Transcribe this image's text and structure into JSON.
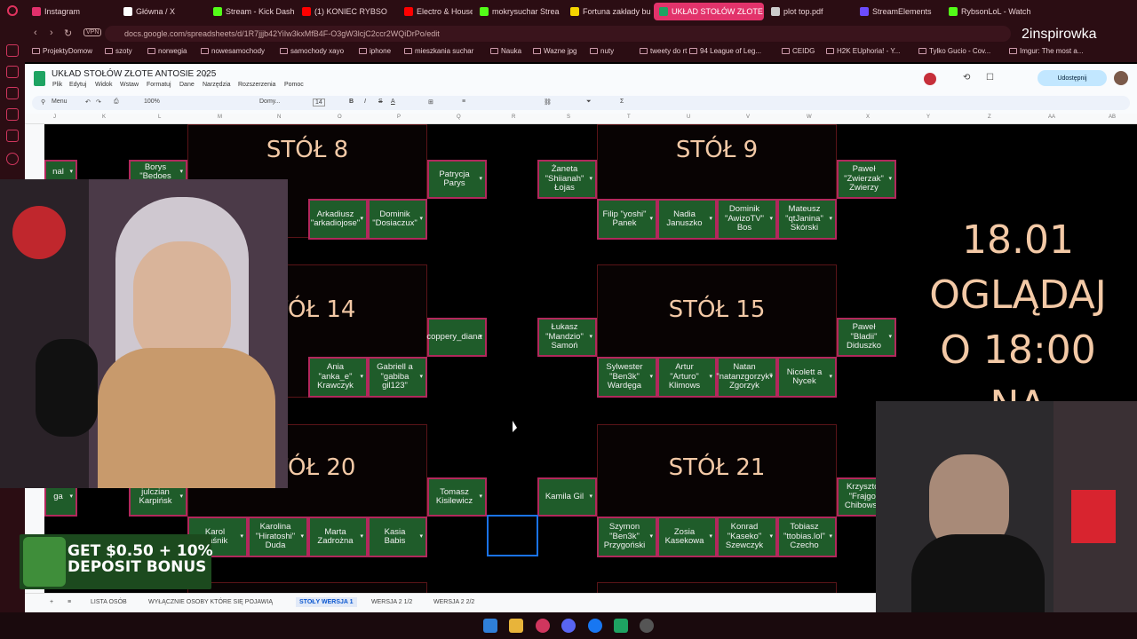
{
  "browser": {
    "tabs": [
      {
        "label": "Instagram",
        "color": "#e1306c"
      },
      {
        "label": "Główna / X",
        "color": "#ffffff"
      },
      {
        "label": "Stream - Kick Dash",
        "color": "#53fc18"
      },
      {
        "label": "(1) KONIEC RYBSO",
        "color": "#ff0000"
      },
      {
        "label": "Electro & House",
        "color": "#ff0000"
      },
      {
        "label": "mokrysuchar Strea",
        "color": "#53fc18"
      },
      {
        "label": "Fortuna zakłady bu",
        "color": "#f5d400"
      },
      {
        "label": "UKŁAD STOŁÓW ZŁOTE A",
        "color": "#1ea362"
      },
      {
        "label": "plot top.pdf",
        "color": "#cccccc"
      },
      {
        "label": "StreamElements",
        "color": "#6b4cff"
      },
      {
        "label": "RybsonLoL - Watch",
        "color": "#53fc18"
      }
    ],
    "url": "docs.google.com/spreadsheets/d/1R7jjjb42YiIw3kxMfB4F-O3gW3lcjC2ccr2WQiDrPo/edit",
    "vpn_badge": "VPN",
    "bookmarks": [
      "ProjektyDomow",
      "szoty",
      "norwegia",
      "nowesamochody",
      "samochody xayo",
      "iphone",
      "mieszkania suchar",
      "Nauka",
      "Wazne jpg",
      "nuty",
      "tweety do rt",
      "94 League of Leg...",
      "CEIDG",
      "H2K EUphoria! - Y...",
      "Tylko Gucio - Cov...",
      "Imgur: The most a..."
    ]
  },
  "sheets": {
    "title": "UKŁAD STOŁÓW ZŁOTE ANTOSIE 2025",
    "menu": [
      "Plik",
      "Edytuj",
      "Widok",
      "Wstaw",
      "Formatuj",
      "Dane",
      "Narzędzia",
      "Rozszerzenia",
      "Pomoc"
    ],
    "share_label": "Udostępnij",
    "toolbar": {
      "menu_label": "Menu",
      "zoom": "100%",
      "font": "Domy...",
      "font_size": "14"
    },
    "columns": [
      "J",
      "K",
      "L",
      "M",
      "N",
      "O",
      "P",
      "Q",
      "R",
      "S",
      "T",
      "U",
      "V",
      "W",
      "X",
      "Y",
      "Z",
      "AA",
      "AB"
    ],
    "sheet_tabs": [
      "LISTA OSÓB",
      "WYŁĄCZNIE OSOBY KTÓRE SIĘ POJAWIĄ",
      "STOŁY WERSJA 1",
      "WERSJA 2 1/2",
      "WERSJA 2 2/2"
    ],
    "active_tab": "STOŁY WERSJA 1"
  },
  "tables": {
    "t8": {
      "name": "STÓŁ 8",
      "seats": [
        "Borys \"Bedoes",
        "Patrycja Parys",
        "Arkadiusz \"arkadiojose\"",
        "Dominik \"Dosiaczux\"",
        "nal"
      ]
    },
    "t9": {
      "name": "STÓŁ 9",
      "seats": [
        "Żaneta \"Shiianah\" Łojas",
        "Paweł \"Zwierzak\" Zwierzy",
        "Filip \"yoshi\" Panek",
        "Nadia Januszko",
        "Dominik \"AwizoTV\" Bos",
        "Mateusz \"qtJanina\" Skórski"
      ]
    },
    "t14": {
      "name": "STÓŁ 14",
      "seats": [
        "coppery_diana",
        "Ania \"anka_e\" Krawczyk",
        "Gabriell a \"gabiba gil123\""
      ]
    },
    "t15": {
      "name": "STÓŁ 15",
      "seats": [
        "Łukasz \"Mandzio\" Samoń",
        "Paweł \"Bladii\" Diduszko",
        "Sylwester \"Ben3k\" Wardęga",
        "Artur \"Arturo\" Klimows",
        "Natan \"natanzgorzyk\" Zgorzyk",
        "Nicolett a Nycek"
      ]
    },
    "t20": {
      "name": "STÓŁ 20",
      "seats": [
        "Tomasz Kisilewicz",
        "julczian Karpińsk",
        "ga",
        "Karol Paśnik",
        "Karolina \"Hiratoshi\" Duda",
        "Marta Zadrożna",
        "Kasia Babis"
      ]
    },
    "t21": {
      "name": "STÓŁ 21",
      "seats": [
        "Kamila Gil",
        "Krzysztof \"Frajgo\" Chibowski",
        "Szymon \"Ben3k\" Przygoński",
        "Zosia Kasekowa",
        "Konrad \"Kaseko\" Szewczyk",
        "Tobiasz \"ttobias.lol\" Czecho"
      ]
    }
  },
  "announcement": {
    "line1": "18.01",
    "line2": "OGLĄDAJ",
    "line3": "O 18:00",
    "line4": "NA"
  },
  "overlay": {
    "ad_text_1": "GET $0.50 + 10%",
    "ad_text_2": "DEPOSIT BONUS",
    "watermark": "2inspirowka"
  }
}
